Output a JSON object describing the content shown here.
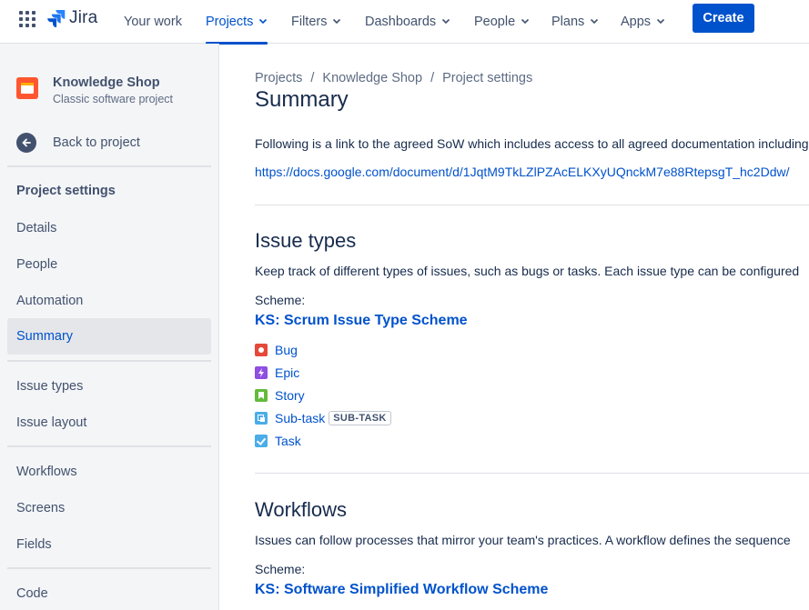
{
  "nav": {
    "logo_text": "Jira",
    "items": [
      {
        "label": "Your work"
      },
      {
        "label": "Projects"
      },
      {
        "label": "Filters"
      },
      {
        "label": "Dashboards"
      },
      {
        "label": "People"
      },
      {
        "label": "Plans"
      },
      {
        "label": "Apps"
      }
    ],
    "create_label": "Create"
  },
  "sidebar": {
    "project_name": "Knowledge Shop",
    "project_type": "Classic software project",
    "back_label": "Back to project",
    "heading": "Project settings",
    "items": [
      "Details",
      "People",
      "Automation",
      "Summary",
      "Issue types",
      "Issue layout",
      "Workflows",
      "Screens",
      "Fields",
      "Code"
    ],
    "selected": "Summary"
  },
  "main": {
    "breadcrumb": [
      "Projects",
      "Knowledge Shop",
      "Project settings"
    ],
    "breadcrumb_sep": "/",
    "title": "Summary",
    "description": "Following is a link to the agreed SoW which includes access to all agreed documentation including",
    "link": "https://docs.google.com/document/d/1JqtM9TkLZlPZAcELKXyUQnckM7e88RtepsgT_hc2Ddw/",
    "issue_types": {
      "heading": "Issue types",
      "description": "Keep track of different types of issues, such as bugs or tasks. Each issue type can be configured",
      "scheme_label": "Scheme:",
      "scheme_name": "KS: Scrum Issue Type Scheme",
      "items": [
        {
          "name": "Bug",
          "icon": "bug-icon"
        },
        {
          "name": "Epic",
          "icon": "epic-icon"
        },
        {
          "name": "Story",
          "icon": "story-icon"
        },
        {
          "name": "Sub-task",
          "icon": "subtask-icon",
          "badge": "SUB-TASK"
        },
        {
          "name": "Task",
          "icon": "task-icon"
        }
      ]
    },
    "workflows": {
      "heading": "Workflows",
      "description": "Issues can follow processes that mirror your team's practices. A workflow defines the sequence",
      "scheme_label": "Scheme:",
      "scheme_name": "KS: Software Simplified Workflow Scheme"
    }
  },
  "colors": {
    "brand": "#0052cc",
    "sidebar_bg": "#f4f5f7",
    "selected_bg": "#e4e6ea"
  }
}
